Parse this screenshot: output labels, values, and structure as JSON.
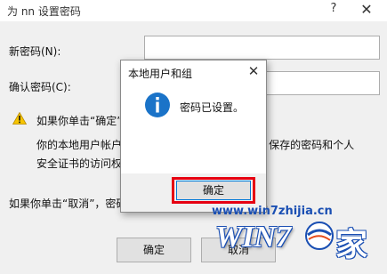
{
  "background_dialog": {
    "title": "为 nn 设置密码",
    "help_glyph": "?",
    "close_glyph": "✕",
    "new_password_label": "新密码(N):",
    "new_password_value": "",
    "confirm_password_label": "确认密码(C):",
    "confirm_password_value": "",
    "warning_text": "如果你单击“确定”",
    "body_line1": "你的本地用户帐户                                     件，保存的密码和个人",
    "body_line2": "安全证书的访问权",
    "body_line3": "如果你单击“取消”，密码                                  数据。",
    "ok_label": "确定",
    "cancel_label": "取消"
  },
  "message_box": {
    "title": "本地用户和组",
    "close_glyph": "✕",
    "message": "密码已设置。",
    "ok_label": "确定"
  },
  "watermark": {
    "url": "www.win7zhijia.cn",
    "logo": "WIN7",
    "logo_char": "家"
  },
  "colors": {
    "highlight": "#e60012",
    "info_icon": "#1a73c8",
    "watermark_blue": "#1a4fb3"
  }
}
